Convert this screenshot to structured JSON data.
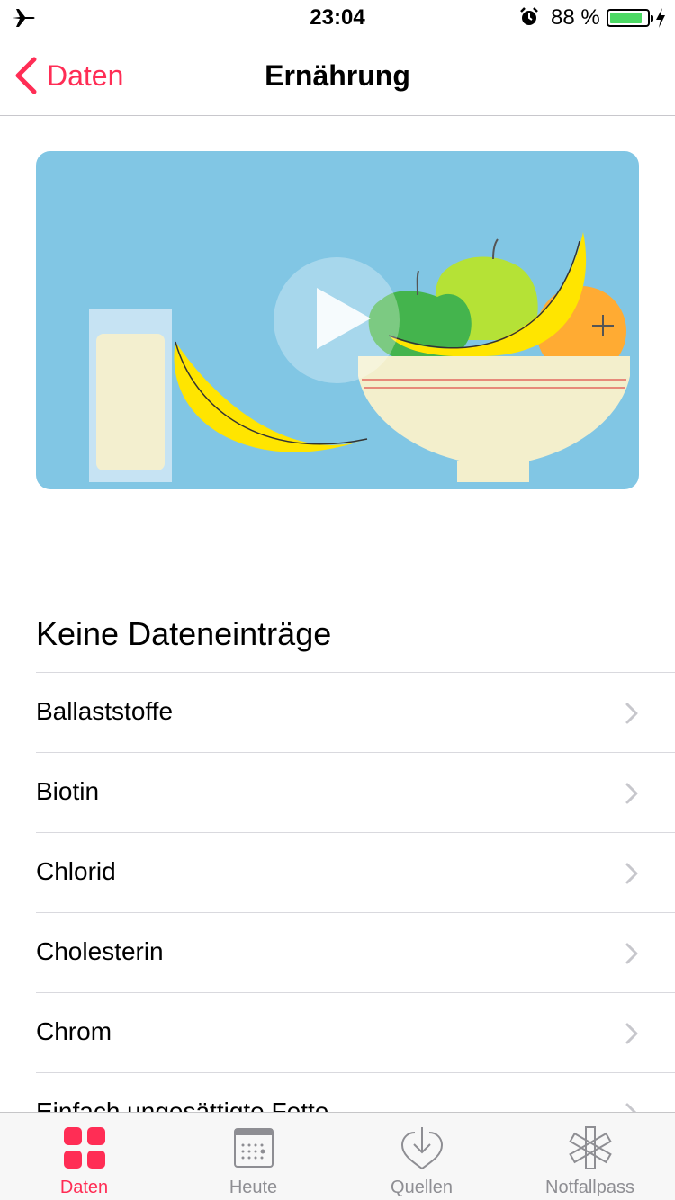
{
  "status_bar": {
    "time": "23:04",
    "battery_percent": "88 %",
    "battery_level": 0.88,
    "icons": [
      "airplane-icon",
      "alarm-icon",
      "battery-icon",
      "charging-bolt-icon"
    ]
  },
  "nav": {
    "back_label": "Daten",
    "title": "Ernährung"
  },
  "hero": {
    "icons": [
      "play-icon",
      "fruit-bowl-illustration",
      "milk-glass-illustration",
      "banana-illustration"
    ]
  },
  "list": {
    "header": "Keine Dateneinträge",
    "items": [
      {
        "label": "Ballaststoffe"
      },
      {
        "label": "Biotin"
      },
      {
        "label": "Chlorid"
      },
      {
        "label": "Cholesterin"
      },
      {
        "label": "Chrom"
      },
      {
        "label": "Einfach ungesättigte Fette"
      }
    ]
  },
  "tabbar": {
    "tabs": [
      {
        "label": "Daten",
        "icon": "grid-icon",
        "active": true
      },
      {
        "label": "Heute",
        "icon": "calendar-icon",
        "active": false
      },
      {
        "label": "Quellen",
        "icon": "heart-download-icon",
        "active": false
      },
      {
        "label": "Notfallpass",
        "icon": "star-of-life-icon",
        "active": false
      }
    ]
  },
  "colors": {
    "accent": "#ff2d55",
    "hero_background": "#81c6e4",
    "inactive_tab": "#8e8e93",
    "battery_fill": "#4cd964"
  }
}
